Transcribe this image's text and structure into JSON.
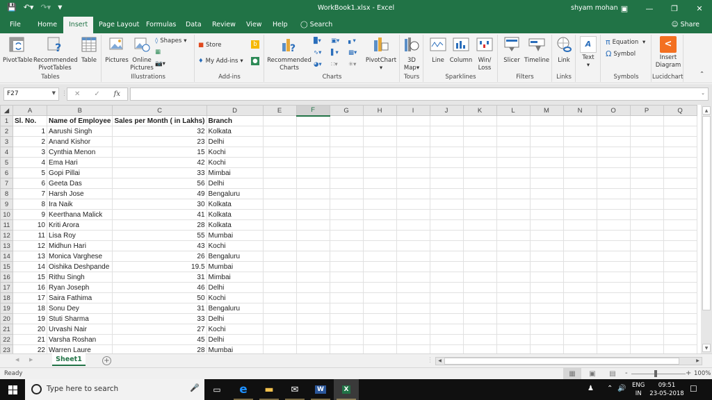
{
  "window": {
    "title": "WorkBook1.xlsx  -  Excel",
    "user": "shyam mohan",
    "controls": [
      "ribbon-display",
      "minimize",
      "restore",
      "close"
    ]
  },
  "quick_access": [
    "save",
    "undo",
    "redo",
    "customize"
  ],
  "tabs": [
    {
      "label": "File",
      "active": false
    },
    {
      "label": "Home",
      "active": false
    },
    {
      "label": "Insert",
      "active": true
    },
    {
      "label": "Page Layout",
      "active": false
    },
    {
      "label": "Formulas",
      "active": false
    },
    {
      "label": "Data",
      "active": false
    },
    {
      "label": "Review",
      "active": false
    },
    {
      "label": "View",
      "active": false
    },
    {
      "label": "Help",
      "active": false
    }
  ],
  "tell_me": "Search",
  "share": "Share",
  "ribbon": {
    "groups": {
      "tables": "Tables",
      "illustrations": "Illustrations",
      "addins": "Add-ins",
      "charts": "Charts",
      "tours": "Tours",
      "sparklines": "Sparklines",
      "filters": "Filters",
      "links": "Links",
      "symbols": "Symbols",
      "lucidchart": "Lucidchart"
    },
    "buttons": {
      "pivottable": "PivotTable",
      "recommended_pivottables_1": "Recommended",
      "recommended_pivottables_2": "PivotTables",
      "table": "Table",
      "pictures": "Pictures",
      "online_pictures_1": "Online",
      "online_pictures_2": "Pictures",
      "shapes": "Shapes",
      "store": "Store",
      "my_addins": "My Add-ins",
      "recommended_charts_1": "Recommended",
      "recommended_charts_2": "Charts",
      "pivotchart": "PivotChart",
      "map3d_1": "3D",
      "map3d_2": "Map",
      "line": "Line",
      "column": "Column",
      "winloss_1": "Win/",
      "winloss_2": "Loss",
      "slicer": "Slicer",
      "timeline": "Timeline",
      "link": "Link",
      "text": "Text",
      "equation": "Equation",
      "symbol": "Symbol",
      "insert_diagram_1": "Insert",
      "insert_diagram_2": "Diagram"
    }
  },
  "formula_bar": {
    "name_box": "F27",
    "fx": "fx",
    "value": ""
  },
  "sheet": {
    "columns": [
      "A",
      "B",
      "C",
      "D",
      "E",
      "F",
      "G",
      "H",
      "I",
      "J",
      "K",
      "L",
      "M",
      "N",
      "O",
      "P",
      "Q"
    ],
    "selected_column": "F",
    "header_row": [
      "Sl. No.",
      "Name of Employee",
      "Sales per Month ( in Lakhs)",
      "Branch"
    ],
    "rows": [
      [
        "1",
        "Aarushi Singh",
        "32",
        "Kolkata"
      ],
      [
        "2",
        "Anand Kishor",
        "23",
        "Delhi"
      ],
      [
        "3",
        "Cynthia Menon",
        "15",
        "Kochi"
      ],
      [
        "4",
        "Ema Hari",
        "42",
        "Kochi"
      ],
      [
        "5",
        "Gopi Pillai",
        "33",
        "Mimbai"
      ],
      [
        "6",
        "Geeta Das",
        "56",
        "Delhi"
      ],
      [
        "7",
        "Harsh Jose",
        "49",
        "Bengaluru"
      ],
      [
        "8",
        "Ira Naik",
        "30",
        "Kolkata"
      ],
      [
        "9",
        "Keerthana Malick",
        "41",
        "Kolkata"
      ],
      [
        "10",
        "Kriti Arora",
        "28",
        "Kolkata"
      ],
      [
        "11",
        "Lisa Roy",
        "55",
        "Mumbai"
      ],
      [
        "12",
        "Midhun Hari",
        "43",
        "Kochi"
      ],
      [
        "13",
        "Monica Varghese",
        "26",
        "Bengaluru"
      ],
      [
        "14",
        "Oishika Deshpande",
        "19.5",
        "Mumbai"
      ],
      [
        "15",
        "Rithu Singh",
        "31",
        "Mimbai"
      ],
      [
        "16",
        "Ryan Joseph",
        "46",
        "Delhi"
      ],
      [
        "17",
        "Saira Fathima",
        "50",
        "Kochi"
      ],
      [
        "18",
        "Sonu Dey",
        "31",
        "Bengaluru"
      ],
      [
        "19",
        "Stuti Sharma",
        "33",
        "Delhi"
      ],
      [
        "20",
        "Urvashi Nair",
        "27",
        "Kochi"
      ],
      [
        "21",
        "Varsha Roshan",
        "45",
        "Delhi"
      ],
      [
        "22",
        "Warren Laure",
        "28",
        "Mumbai"
      ]
    ]
  },
  "sheet_tabs": [
    {
      "label": "Sheet1",
      "active": true
    }
  ],
  "status": {
    "text": "Ready",
    "zoom": "100%",
    "zoom_minus": "-",
    "zoom_plus": "+"
  },
  "taskbar": {
    "search_placeholder": "Type here to search",
    "apps": [
      "task-view",
      "edge",
      "file-explorer",
      "mail",
      "word",
      "excel"
    ],
    "active_app": "excel",
    "lang_1": "ENG",
    "lang_2": "IN",
    "time": "09:51",
    "date": "23-05-2018"
  },
  "colors": {
    "accent": "#217346",
    "ribbon_bg": "#f3f3f3",
    "taskbar_bg": "#101010"
  }
}
